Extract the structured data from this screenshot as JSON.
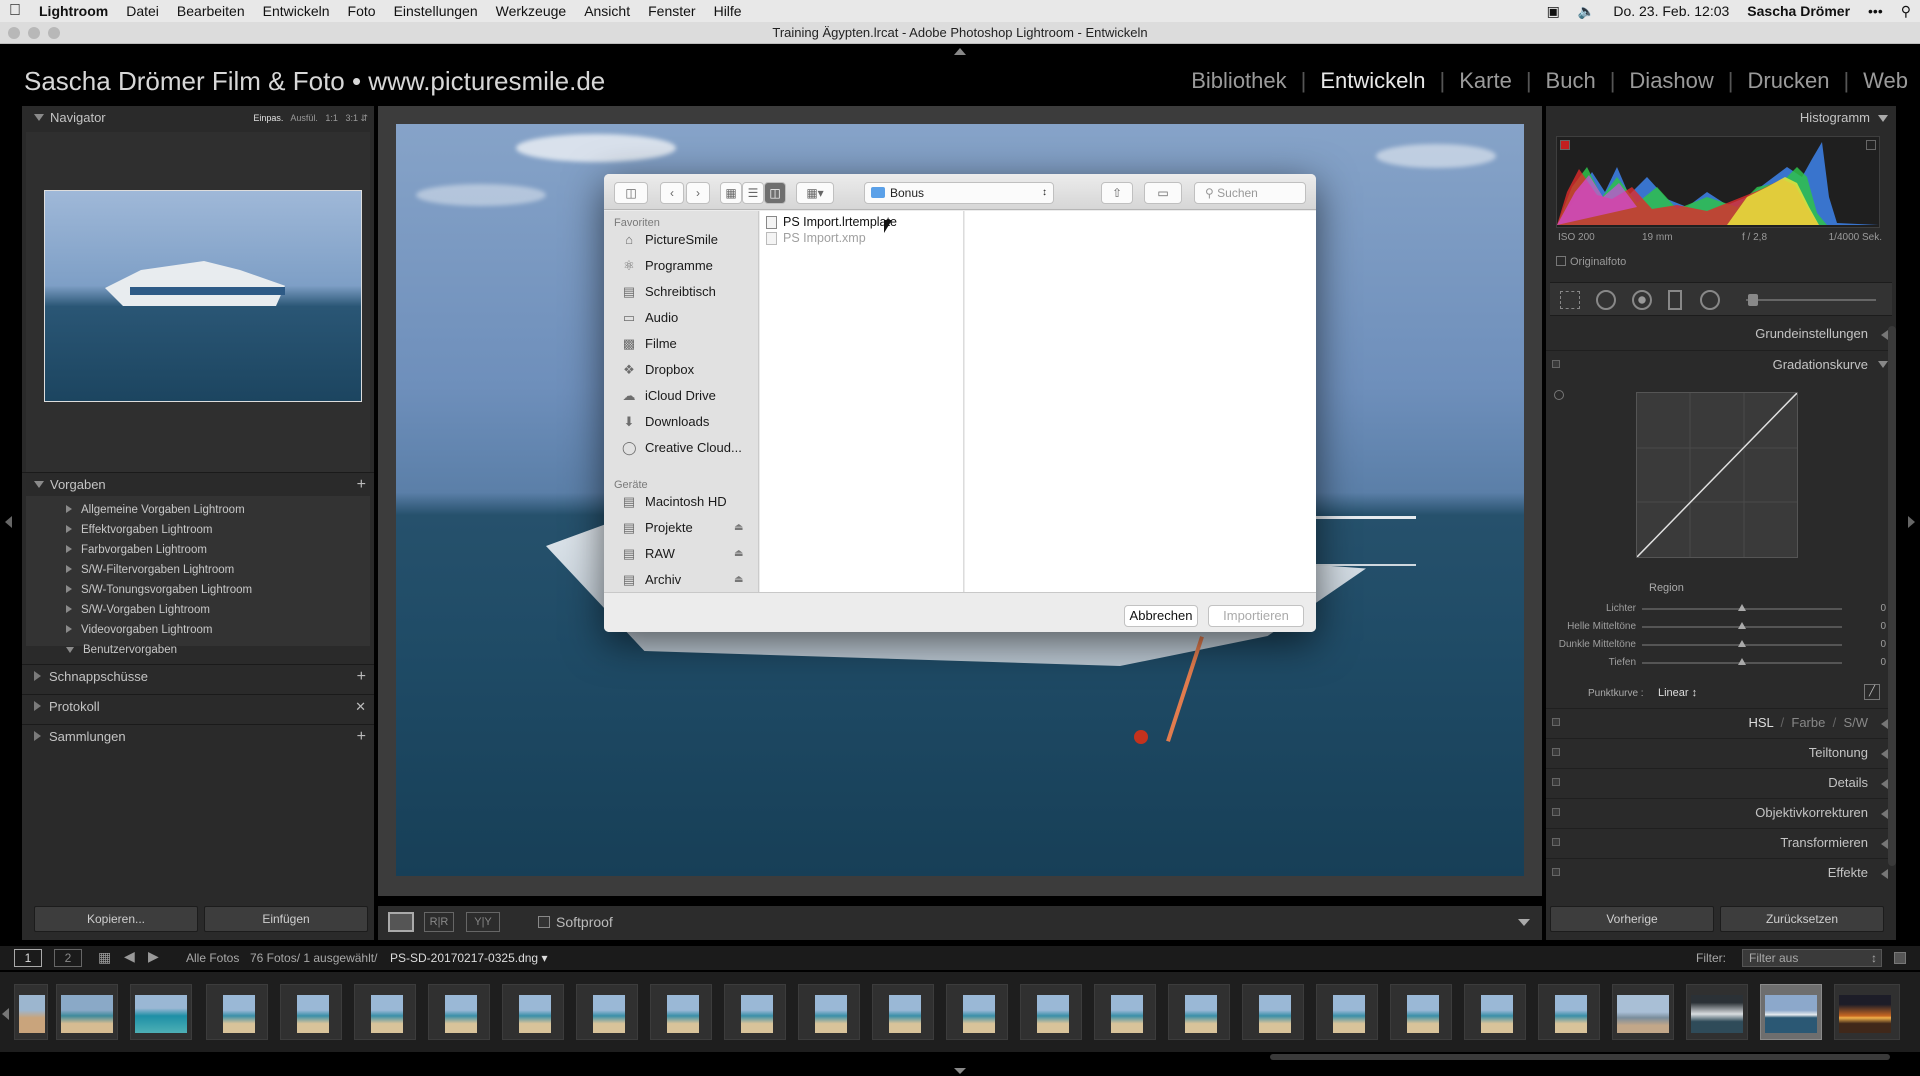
{
  "menubar": {
    "apple": "",
    "app_name": "Lightroom",
    "items": [
      "Datei",
      "Bearbeiten",
      "Entwickeln",
      "Foto",
      "Einstellungen",
      "Werkzeuge",
      "Ansicht",
      "Fenster",
      "Hilfe"
    ],
    "datetime": "Do. 23. Feb. 12:03",
    "user": "Sascha Drömer"
  },
  "window": {
    "title": "Training Ägypten.lrcat - Adobe Photoshop Lightroom - Entwickeln"
  },
  "identity_plate": {
    "brand": "Sascha Drömer Film & Foto • www.picturesmile.de"
  },
  "modules": [
    "Bibliothek",
    "Entwickeln",
    "Karte",
    "Buch",
    "Diashow",
    "Drucken",
    "Web"
  ],
  "active_module": "Entwickeln",
  "left_panel": {
    "navigator": {
      "title": "Navigator",
      "zoom_options": [
        "Einpas.",
        "Ausfül.",
        "1:1",
        "3:1"
      ]
    },
    "presets": {
      "title": "Vorgaben",
      "items": [
        "Allgemeine Vorgaben Lightroom",
        "Effektvorgaben Lightroom",
        "Farbvorgaben Lightroom",
        "S/W-Filtervorgaben Lightroom",
        "S/W-Tonungsvorgaben Lightroom",
        "S/W-Vorgaben Lightroom",
        "Videovorgaben Lightroom",
        "Benutzervorgaben"
      ]
    },
    "snapshots": "Schnappschüsse",
    "history": "Protokoll",
    "collections": "Sammlungen",
    "copy_button": "Kopieren...",
    "paste_button": "Einfügen"
  },
  "dialog": {
    "location": "Bonus",
    "search_placeholder": "Suchen",
    "favorites_label": "Favoriten",
    "favorites": [
      {
        "label": "PictureSmile",
        "icon": "house-icon"
      },
      {
        "label": "Programme",
        "icon": "apps-icon"
      },
      {
        "label": "Schreibtisch",
        "icon": "desktop-icon"
      },
      {
        "label": "Audio",
        "icon": "folder-icon"
      },
      {
        "label": "Filme",
        "icon": "film-icon"
      },
      {
        "label": "Dropbox",
        "icon": "dropbox-icon"
      },
      {
        "label": "iCloud Drive",
        "icon": "cloud-icon"
      },
      {
        "label": "Downloads",
        "icon": "download-icon"
      },
      {
        "label": "Creative Cloud...",
        "icon": "creative-cloud-icon"
      }
    ],
    "devices_label": "Geräte",
    "devices": [
      {
        "label": "Macintosh HD",
        "eject": false
      },
      {
        "label": "Projekte",
        "eject": true
      },
      {
        "label": "RAW",
        "eject": true
      },
      {
        "label": "Archiv",
        "eject": true
      }
    ],
    "files": [
      {
        "name": "PS Import.lrtemplate",
        "enabled": true
      },
      {
        "name": "PS Import.xmp",
        "enabled": false
      }
    ],
    "cancel_button": "Abbrechen",
    "import_button": "Importieren"
  },
  "center_toolbar": {
    "softproof": "Softproof"
  },
  "right_panel": {
    "histogram_title": "Histogramm",
    "exif": {
      "iso": "ISO 200",
      "focal": "19 mm",
      "aperture": "f / 2,8",
      "shutter": "1/4000 Sek."
    },
    "original_photo": "Originalfoto",
    "sections": {
      "basic": "Grundeinstellungen",
      "tone_curve": "Gradationskurve",
      "hsl": "HSL",
      "color": "Farbe",
      "bw": "S/W",
      "split": "Teiltonung",
      "detail": "Details",
      "lens": "Objektivkorrekturen",
      "transform": "Transformieren",
      "effects": "Effekte"
    },
    "region_label": "Region",
    "sliders": [
      {
        "label": "Lichter",
        "value": "0"
      },
      {
        "label": "Helle Mitteltöne",
        "value": "0"
      },
      {
        "label": "Dunkle Mitteltöne",
        "value": "0"
      },
      {
        "label": "Tiefen",
        "value": "0"
      }
    ],
    "point_curve_label": "Punktkurve :",
    "point_curve_value": "Linear",
    "previous_button": "Vorherige",
    "reset_button": "Zurücksetzen"
  },
  "filmstrip_bar": {
    "page1": "1",
    "page2": "2",
    "source": "Alle Fotos",
    "count": "76 Fotos/ 1 ausgewählt/",
    "filename": "PS-SD-20170217-0325.dng",
    "filter_label": "Filter:",
    "filter_value": "Filter aus"
  },
  "colors": {
    "accent": "#e8e8e8",
    "panel": "#2a2a2a",
    "dialog": "#ececec",
    "folder": "#5aa0e8"
  }
}
